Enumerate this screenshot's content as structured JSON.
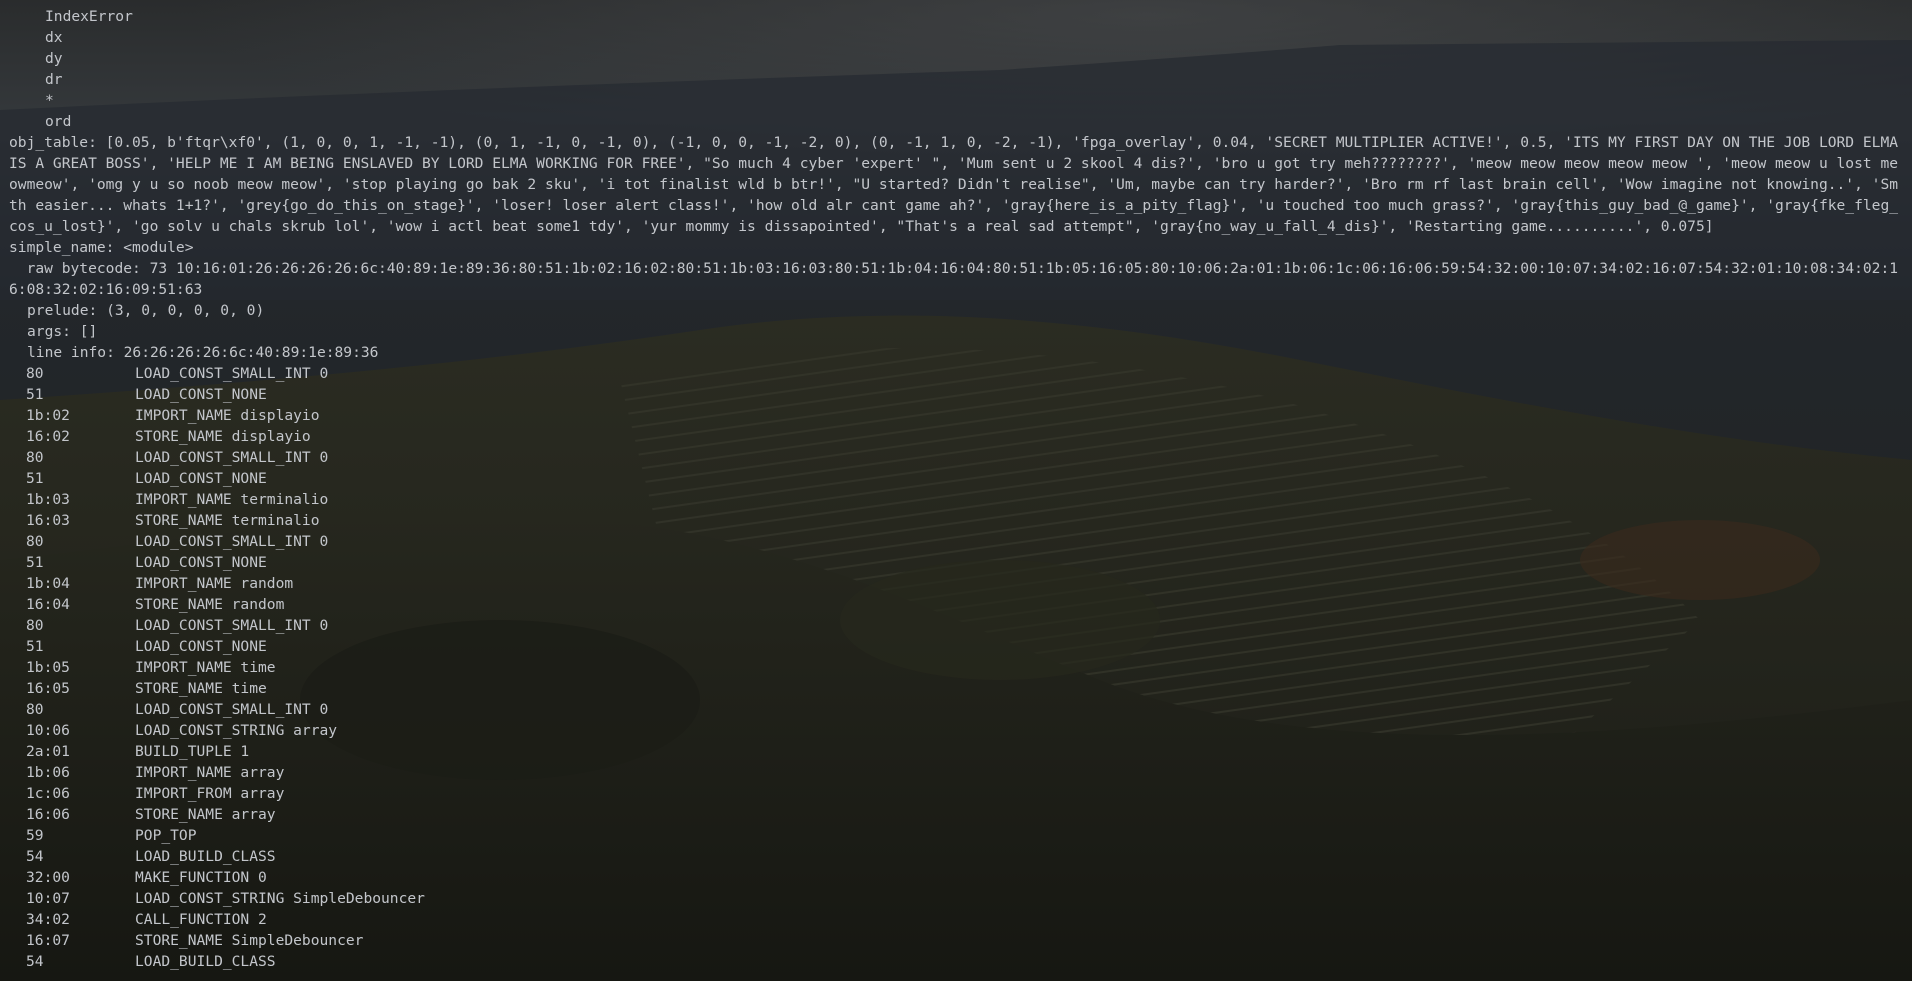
{
  "theme": {
    "text_color": "#c3c6cb",
    "background_color": "#1e2020"
  },
  "terminal": {
    "names_list": [
      "IndexError",
      "dx",
      "dy",
      "dr",
      "*",
      "ord"
    ],
    "obj_table": "obj_table: [0.05, b'ftqr\\xf0', (1, 0, 0, 1, -1, -1), (0, 1, -1, 0, -1, 0), (-1, 0, 0, -1, -2, 0), (0, -1, 1, 0, -2, -1), 'fpga_overlay', 0.04, 'SECRET MULTIPLIER ACTIVE!', 0.5, 'ITS MY FIRST DAY ON THE JOB LORD ELMA IS A GREAT BOSS', 'HELP ME I AM BEING ENSLAVED BY LORD ELMA WORKING FOR FREE', \"So much 4 cyber 'expert' \", 'Mum sent u 2 skool 4 dis?', 'bro u got try meh????????', 'meow meow meow meow meow ', 'meow meow u lost meowmeow', 'omg y u so noob meow meow', 'stop playing go bak 2 sku', 'i tot finalist wld b btr!', \"U started? Didn't realise\", 'Um, maybe can try harder?', 'Bro rm rf last brain cell', 'Wow imagine not knowing..', 'Smth easier... whats 1+1?', 'grey{go_do_this_on_stage}', 'loser! loser alert class!', 'how old alr cant game ah?', 'gray{here_is_a_pity_flag}', 'u touched too much grass?', 'gray{this_guy_bad_@_game}', 'gray{fke_fleg_cos_u_lost}', 'go solv u chals skrub lol', 'wow i actl beat some1 tdy', 'yur mommy is dissapointed', \"That's a real sad attempt\", 'gray{no_way_u_fall_4_dis}', 'Restarting game..........', 0.075]",
    "simple_name": "simple_name: <module>",
    "raw_bytecode": "  raw bytecode: 73 10:16:01:26:26:26:26:6c:40:89:1e:89:36:80:51:1b:02:16:02:80:51:1b:03:16:03:80:51:1b:04:16:04:80:51:1b:05:16:05:80:10:06:2a:01:1b:06:1c:06:16:06:59:54:32:00:10:07:34:02:16:07:54:32:01:10:08:34:02:16:08:32:02:16:09:51:63",
    "prelude": "prelude: (3, 0, 0, 0, 0, 0)",
    "args": "args: []",
    "line_info": "line info: 26:26:26:26:6c:40:89:1e:89:36",
    "ops": [
      {
        "code": "80",
        "name": "LOAD_CONST_SMALL_INT 0"
      },
      {
        "code": "51",
        "name": "LOAD_CONST_NONE"
      },
      {
        "code": "1b:02",
        "name": "IMPORT_NAME displayio"
      },
      {
        "code": "16:02",
        "name": "STORE_NAME displayio"
      },
      {
        "code": "80",
        "name": "LOAD_CONST_SMALL_INT 0"
      },
      {
        "code": "51",
        "name": "LOAD_CONST_NONE"
      },
      {
        "code": "1b:03",
        "name": "IMPORT_NAME terminalio"
      },
      {
        "code": "16:03",
        "name": "STORE_NAME terminalio"
      },
      {
        "code": "80",
        "name": "LOAD_CONST_SMALL_INT 0"
      },
      {
        "code": "51",
        "name": "LOAD_CONST_NONE"
      },
      {
        "code": "1b:04",
        "name": "IMPORT_NAME random"
      },
      {
        "code": "16:04",
        "name": "STORE_NAME random"
      },
      {
        "code": "80",
        "name": "LOAD_CONST_SMALL_INT 0"
      },
      {
        "code": "51",
        "name": "LOAD_CONST_NONE"
      },
      {
        "code": "1b:05",
        "name": "IMPORT_NAME time"
      },
      {
        "code": "16:05",
        "name": "STORE_NAME time"
      },
      {
        "code": "80",
        "name": "LOAD_CONST_SMALL_INT 0"
      },
      {
        "code": "10:06",
        "name": "LOAD_CONST_STRING array"
      },
      {
        "code": "2a:01",
        "name": "BUILD_TUPLE 1"
      },
      {
        "code": "1b:06",
        "name": "IMPORT_NAME array"
      },
      {
        "code": "1c:06",
        "name": "IMPORT_FROM array"
      },
      {
        "code": "16:06",
        "name": "STORE_NAME array"
      },
      {
        "code": "59",
        "name": "POP_TOP"
      },
      {
        "code": "54",
        "name": "LOAD_BUILD_CLASS"
      },
      {
        "code": "32:00",
        "name": "MAKE_FUNCTION 0"
      },
      {
        "code": "10:07",
        "name": "LOAD_CONST_STRING SimpleDebouncer"
      },
      {
        "code": "34:02",
        "name": "CALL_FUNCTION 2"
      },
      {
        "code": "16:07",
        "name": "STORE_NAME SimpleDebouncer"
      },
      {
        "code": "54",
        "name": "LOAD_BUILD_CLASS"
      }
    ]
  }
}
